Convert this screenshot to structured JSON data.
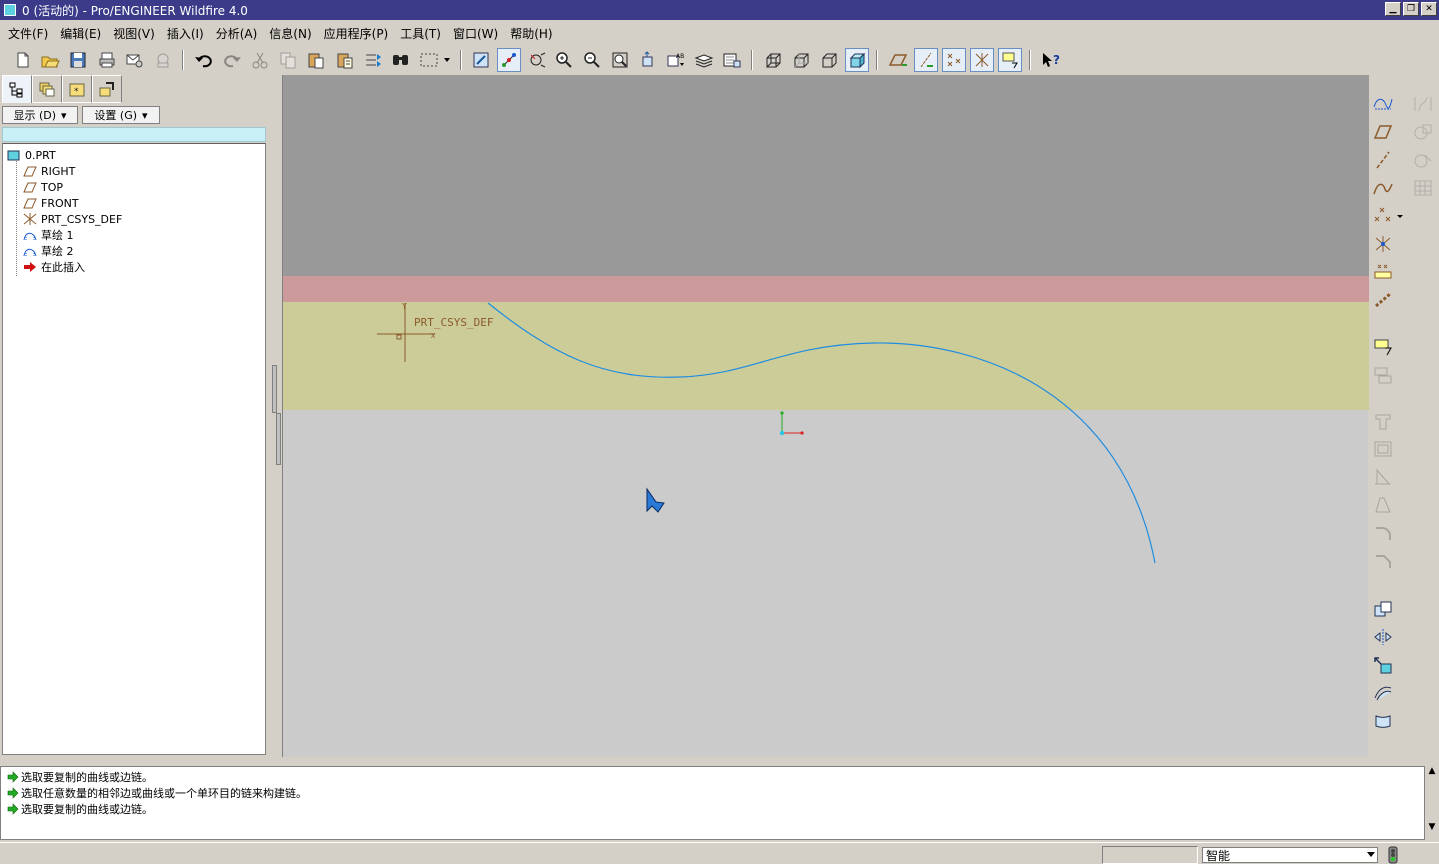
{
  "window": {
    "title": "0 (活动的) - Pro/ENGINEER Wildfire 4.0",
    "controls": [
      "minimize",
      "restore",
      "close"
    ]
  },
  "menu": [
    {
      "label": "文件(F)",
      "icon": "none"
    },
    {
      "label": "编辑(E)",
      "icon": "none"
    },
    {
      "label": "视图(V)",
      "icon": "none"
    },
    {
      "label": "插入(I)",
      "icon": "none"
    },
    {
      "label": "分析(A)",
      "icon": "none"
    },
    {
      "label": "信息(N)",
      "icon": "none"
    },
    {
      "label": "应用程序(P)",
      "icon": "none"
    },
    {
      "label": "工具(T)",
      "icon": "none"
    },
    {
      "label": "窗口(W)",
      "icon": "none"
    },
    {
      "label": "帮助(H)",
      "icon": "none"
    }
  ],
  "toolbar": {
    "icons": [
      "new-file-icon",
      "open-folder-icon",
      "save-icon",
      "print-icon",
      "send-mail-icon",
      "mail-attach-icon",
      "undo-icon",
      "redo-icon",
      "cut-icon",
      "copy-icon",
      "paste-icon",
      "paste-special-icon",
      "regenerate-icon",
      "find-icon",
      "select-box-icon",
      "repaint-icon",
      "spin-center-icon",
      "orient-mode-icon",
      "zoom-in-icon",
      "zoom-out-icon",
      "refit-icon",
      "reorient-icon",
      "saved-views-icon",
      "layers-icon",
      "view-manager-icon",
      "wireframe-icon",
      "hidden-line-icon",
      "no-hidden-icon",
      "shading-icon",
      "datum-plane-display-icon",
      "datum-axis-display-icon",
      "datum-point-display-icon",
      "csys-display-icon",
      "annotation-display-icon",
      "context-help-icon"
    ]
  },
  "left_panel": {
    "tabs": [
      "model-tree-tab",
      "layer-tree-tab",
      "favorites-tab",
      "connection-tab"
    ],
    "show_menu": "显示 (D)",
    "settings_menu": "设置 (G)",
    "tree": [
      {
        "label": "0.PRT",
        "icon": "part-icon"
      },
      {
        "label": "RIGHT",
        "icon": "datum-plane-icon"
      },
      {
        "label": "TOP",
        "icon": "datum-plane-icon"
      },
      {
        "label": "FRONT",
        "icon": "datum-plane-icon"
      },
      {
        "label": "PRT_CSYS_DEF",
        "icon": "csys-icon"
      },
      {
        "label": "草绘 1",
        "icon": "sketch-icon"
      },
      {
        "label": "草绘 2",
        "icon": "sketch-icon"
      },
      {
        "label": "在此插入",
        "icon": "insert-here-arrow-icon"
      }
    ]
  },
  "viewport": {
    "csys_label": "PRT_CSYS_DEF",
    "axis_y": "Y",
    "axis_x": "X",
    "colors": {
      "background": "#cbcbcb",
      "top_band": "#999999",
      "pink_band": "#cc9a9a",
      "yellow_plane": "#cccc99",
      "curve": "#1f8de0",
      "csys": "#8b5a2b"
    }
  },
  "right_toolbar": {
    "icons": [
      "sketch-tool-icon",
      "datum-plane-tool-icon",
      "datum-axis-tool-icon",
      "datum-curve-tool-icon",
      "datum-point-tool-icon",
      "more-dropdown-icon",
      "offset-csys-icon",
      "sketched-point-icon",
      "analysis-feature-icon",
      "insert-note-icon",
      "annotation-feature-icon",
      "hole-tool-icon",
      "shell-tool-icon",
      "rib-tool-icon",
      "draft-tool-icon",
      "round-tool-icon",
      "chamfer-tool-icon",
      "copy-feature-icon",
      "mirror-tool-icon",
      "merge-tool-icon",
      "trim-tool-icon",
      "extend-tool-icon"
    ]
  },
  "messages": [
    {
      "text": "选取要复制的曲线或边链。",
      "icon": "green-arrow-icon"
    },
    {
      "text": "选取任意数量的相邻边或曲线或一个单环目的链来构建链。",
      "icon": "green-arrow-icon"
    },
    {
      "text": "选取要复制的曲线或边链。",
      "icon": "green-arrow-icon"
    }
  ],
  "status": {
    "filter_value": "智能"
  }
}
